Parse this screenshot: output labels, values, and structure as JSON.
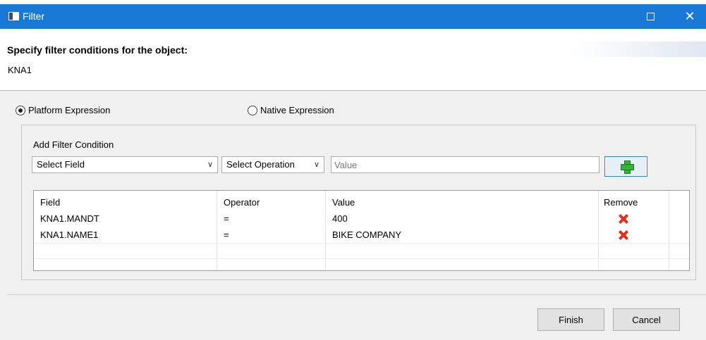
{
  "window": {
    "title": "Filter"
  },
  "header": {
    "heading": "Specify filter conditions for the object:",
    "object_name": "KNA1"
  },
  "expression_mode": {
    "options": [
      {
        "label": "Platform Expression",
        "selected": true
      },
      {
        "label": "Native Expression",
        "selected": false
      }
    ]
  },
  "add_filter": {
    "title": "Add Filter Condition",
    "field_select": "Select Field",
    "operation_select": "Select Operation",
    "value_placeholder": "Value",
    "add_icon": "green-plus-icon"
  },
  "conditions": {
    "columns": [
      "Field",
      "Operator",
      "Value",
      "Remove"
    ],
    "rows": [
      {
        "field": "KNA1.MANDT",
        "operator": "=",
        "value": "400",
        "remove_icon": "red-x-icon"
      },
      {
        "field": "KNA1.NAME1",
        "operator": "=",
        "value": "BIKE COMPANY",
        "remove_icon": "red-x-icon"
      }
    ]
  },
  "buttons": {
    "finish": "Finish",
    "cancel": "Cancel"
  },
  "colors": {
    "titlebar": "#1a78d6",
    "add_plus": "#37b336",
    "remove_x": "#e03020"
  }
}
